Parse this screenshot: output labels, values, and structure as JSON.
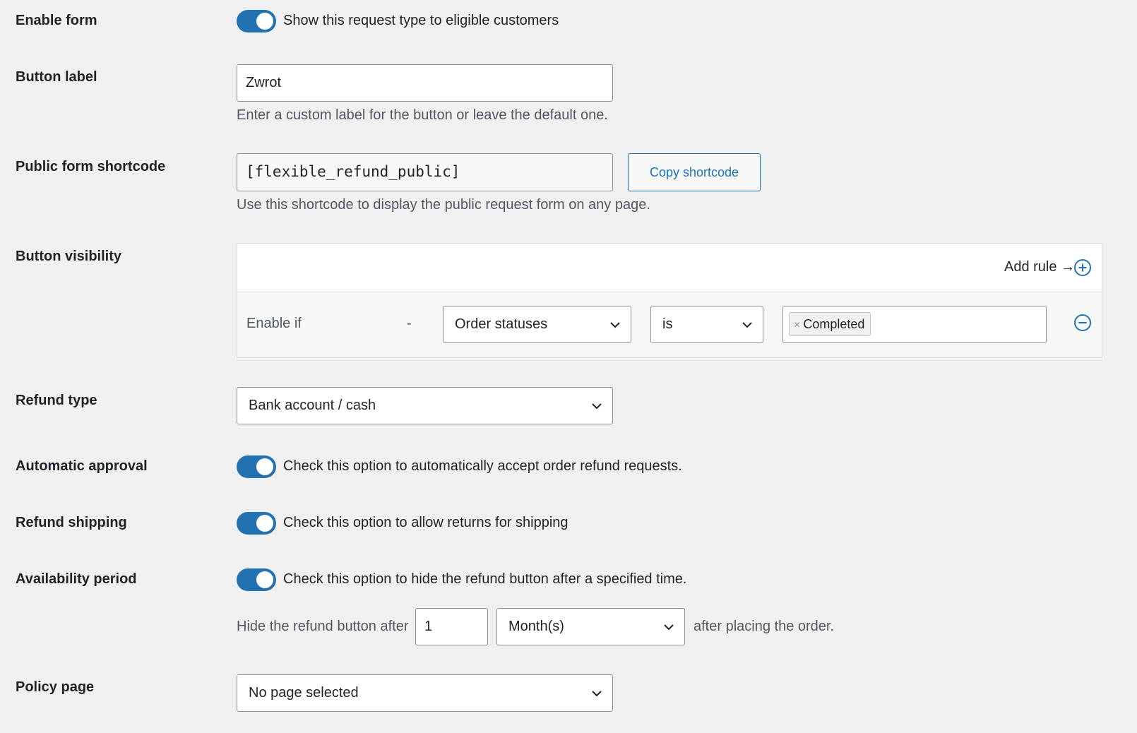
{
  "enable_form": {
    "label": "Enable form",
    "toggle_on": true,
    "description": "Show this request type to eligible customers"
  },
  "button_label": {
    "label": "Button label",
    "value": "Zwrot",
    "help": "Enter a custom label for the button or leave the default one."
  },
  "public_shortcode": {
    "label": "Public form shortcode",
    "value": "[flexible_refund_public]",
    "copy_button": "Copy shortcode",
    "help": "Use this shortcode to display the public request form on any page."
  },
  "button_visibility": {
    "label": "Button visibility",
    "add_rule": "Add rule →",
    "rule": {
      "prefix": "Enable if",
      "dash": "-",
      "field": "Order statuses",
      "operator": "is",
      "values": [
        "Completed"
      ],
      "remove_symbol": "×"
    }
  },
  "refund_type": {
    "label": "Refund type",
    "selected": "Bank account / cash"
  },
  "automatic_approval": {
    "label": "Automatic approval",
    "toggle_on": true,
    "description": "Check this option to automatically accept order refund requests."
  },
  "refund_shipping": {
    "label": "Refund shipping",
    "toggle_on": true,
    "description": "Check this option to allow returns for shipping"
  },
  "availability_period": {
    "label": "Availability period",
    "toggle_on": true,
    "description": "Check this option to hide the refund button after a specified time.",
    "hide_prefix": "Hide the refund button after",
    "amount": "1",
    "unit": "Month(s)",
    "hide_suffix": "after placing the order."
  },
  "policy_page": {
    "label": "Policy page",
    "selected": "No page selected"
  },
  "colors": {
    "accent": "#2271b1",
    "background": "#f0f0f1"
  },
  "icons": {
    "add_rule": "plus-circle-icon",
    "remove_rule": "minus-circle-icon",
    "select_arrow": "chevron-down-icon"
  }
}
